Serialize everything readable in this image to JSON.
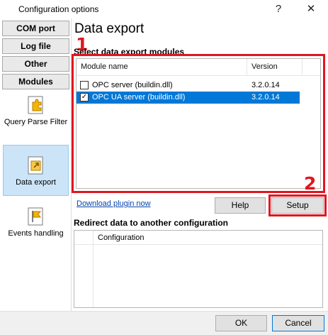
{
  "window": {
    "title": "Configuration options",
    "help_glyph": "?",
    "close_glyph": "✕"
  },
  "sidebar": {
    "categories": [
      {
        "label": "COM port"
      },
      {
        "label": "Log file"
      },
      {
        "label": "Other"
      },
      {
        "label": "Modules"
      }
    ],
    "modules": [
      {
        "label": "Query Parse Filter",
        "icon": "puzzle-icon"
      },
      {
        "label": "Data export",
        "icon": "export-icon",
        "selected": true
      },
      {
        "label": "Events handling",
        "icon": "flag-icon"
      }
    ]
  },
  "main": {
    "title": "Data export",
    "marker_1": "1",
    "marker_2": "2",
    "modules_heading": "Select data export modules",
    "columns": {
      "name": "Module name",
      "version": "Version"
    },
    "rows": [
      {
        "name": "OPC server (buildin.dll)",
        "version": "3.2.0.14",
        "checked": false,
        "selected": false
      },
      {
        "name": "OPC UA server (buildin.dll)",
        "version": "3.2.0.14",
        "checked": true,
        "selected": true
      }
    ],
    "download_link": "Download plugin now",
    "help_button": "Help",
    "setup_button": "Setup",
    "redirect_heading": "Redirect data to another configuration",
    "config_column": "Configuration"
  },
  "footer": {
    "ok_button": "OK",
    "cancel_button": "Cancel"
  },
  "colors": {
    "highlight_red": "#e0161f",
    "selection_blue": "#0078d7",
    "link_blue": "#0645ad"
  }
}
